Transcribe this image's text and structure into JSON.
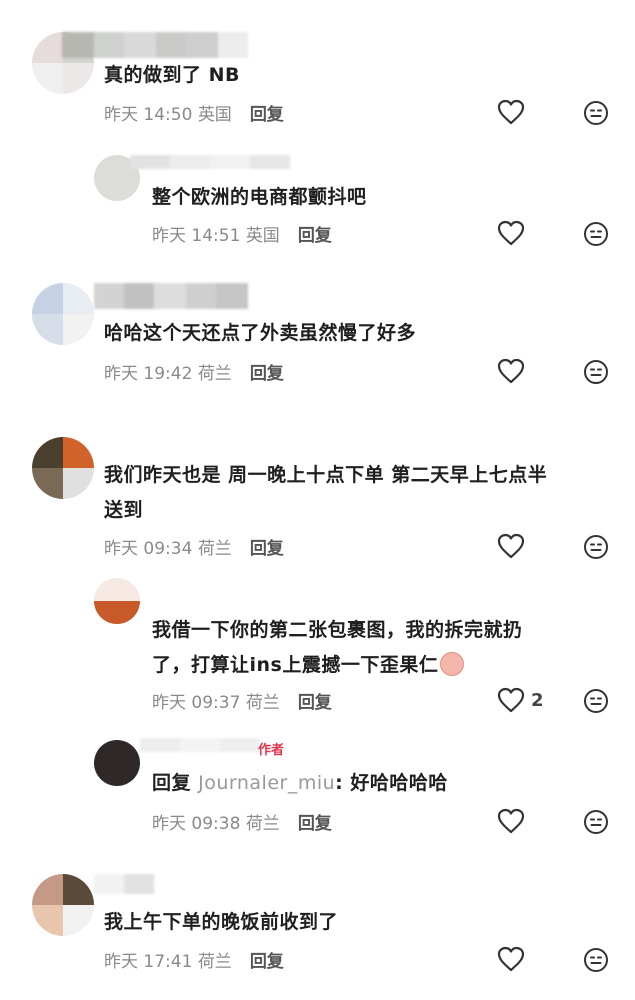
{
  "comments": [
    {
      "text": "真的做到了 NB",
      "date": "昨天 14:50",
      "location": "英国",
      "reply_label": "回复"
    },
    {
      "text": "整个欧洲的电商都颤抖吧",
      "date": "昨天 14:51",
      "location": "英国",
      "reply_label": "回复"
    },
    {
      "text": "哈哈这个天还点了外卖虽然慢了好多",
      "date": "昨天 19:42",
      "location": "荷兰",
      "reply_label": "回复"
    },
    {
      "text_line1": "我们昨天也是 周一晚上十点下单 第二天早上七点半",
      "text_line2": "送到",
      "date": "昨天 09:34",
      "location": "荷兰",
      "reply_label": "回复"
    },
    {
      "text_line1": "我借一下你的第二张包裹图，我的拆完就扔",
      "text_line2": "了，打算让ins上震撼一下歪果仁",
      "date": "昨天 09:37",
      "location": "荷兰",
      "reply_label": "回复",
      "like_count": "2"
    },
    {
      "author_tag": "作者",
      "reply_prefix": "回复 ",
      "reply_to": "Journaler_miu",
      "reply_text": ": 好哈哈哈哈",
      "date": "昨天 09:38",
      "location": "荷兰",
      "reply_label": "回复"
    },
    {
      "text": "我上午下单的晚饭前收到了",
      "date": "昨天 17:41",
      "location": "荷兰",
      "reply_label": "回复"
    }
  ],
  "icons": {
    "like": "heart-outline-icon",
    "dislike": "neutral-face-icon",
    "emoji": "crying-face-emoji"
  },
  "colors": {
    "text": "#1f1f1f",
    "meta": "#8a8a8a",
    "author_tag": "#e0364e"
  }
}
